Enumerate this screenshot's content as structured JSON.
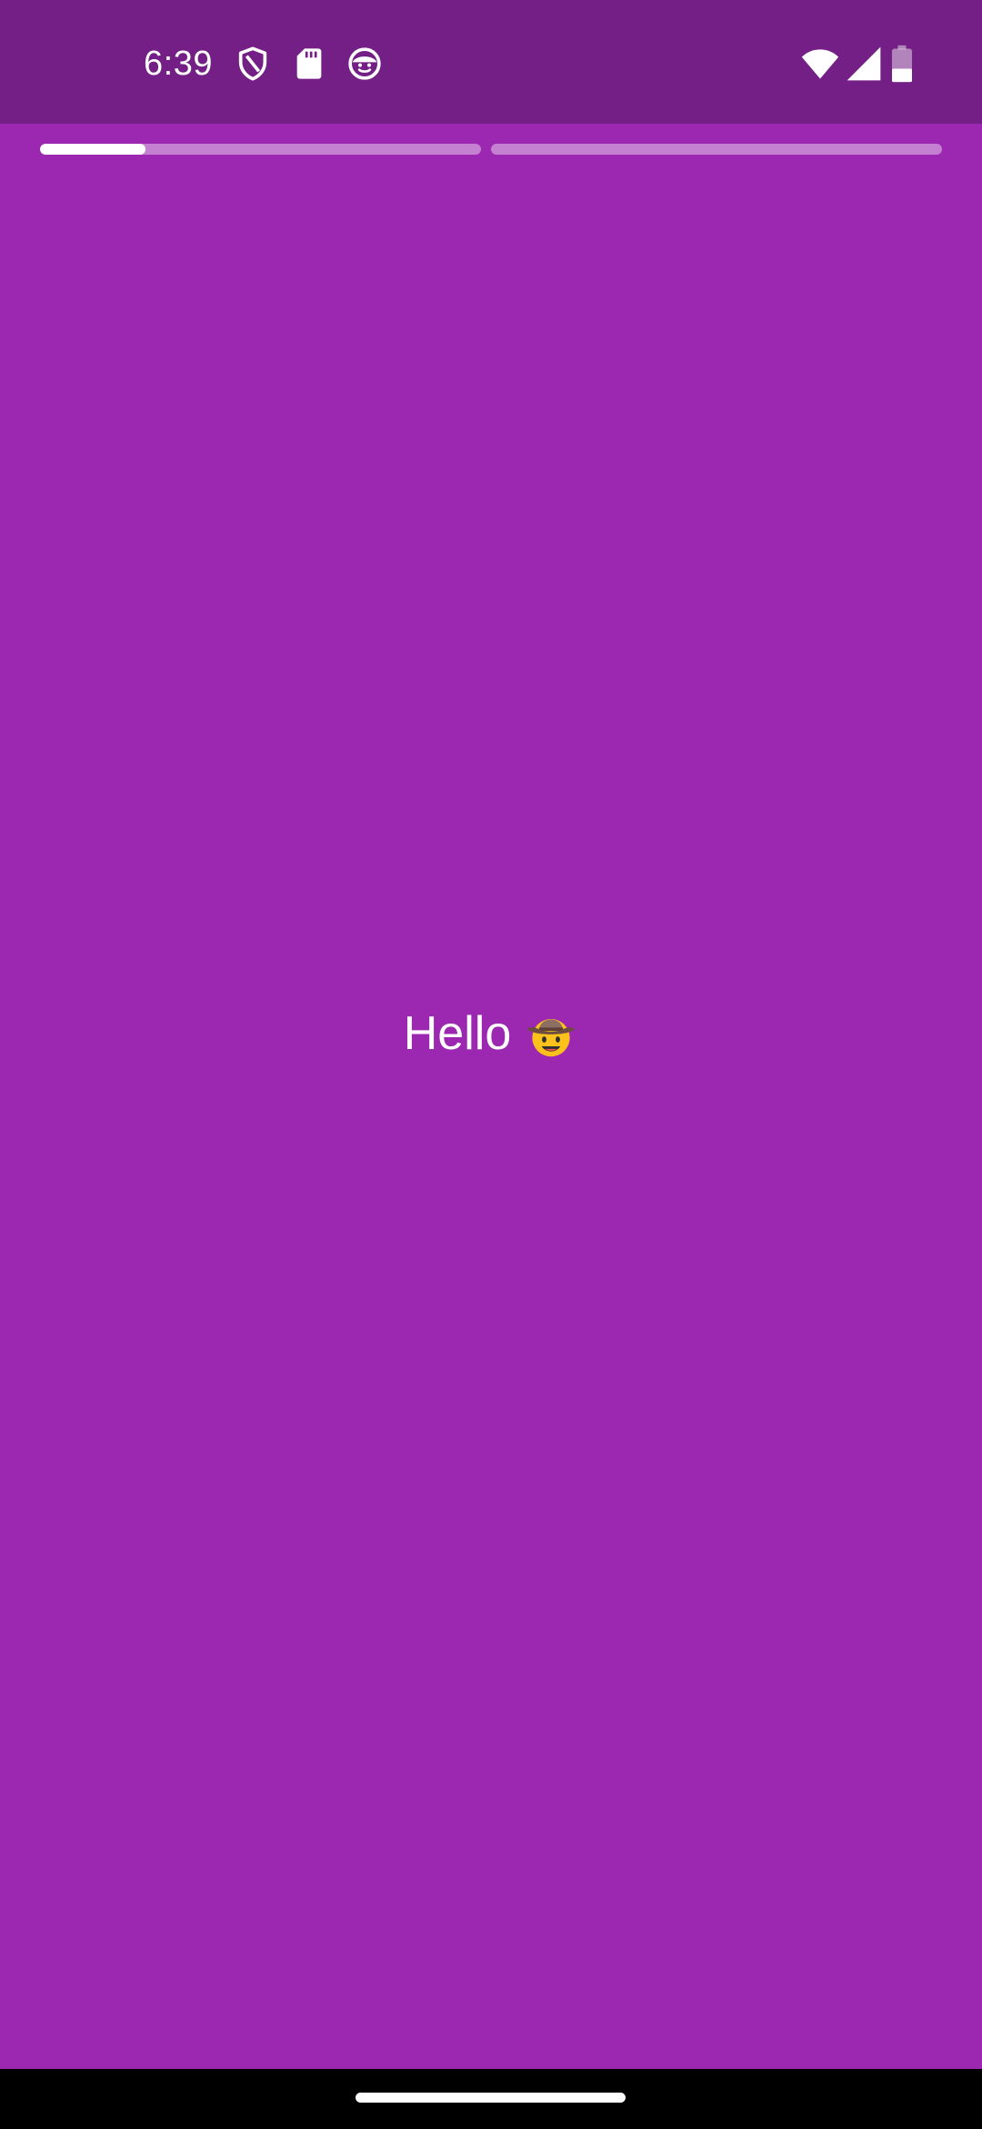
{
  "status_bar": {
    "time": "6:39",
    "left_icons": [
      "shield-icon",
      "sd-card-icon",
      "face-icon"
    ],
    "right_icons": [
      "wifi-icon",
      "cell-signal-icon",
      "battery-icon"
    ],
    "background": "#741f85"
  },
  "stories": {
    "segments": [
      {
        "progress": 0.24
      },
      {
        "progress": 0
      }
    ],
    "track_color": "rgba(255,255,255,0.42)",
    "fill_color": "#ffffff"
  },
  "content": {
    "greeting": "Hello",
    "emoji": "cowboy-hat-face-icon",
    "background": "#9c27b0"
  },
  "nav": {
    "gesture_handle": "home-gesture-pill"
  }
}
